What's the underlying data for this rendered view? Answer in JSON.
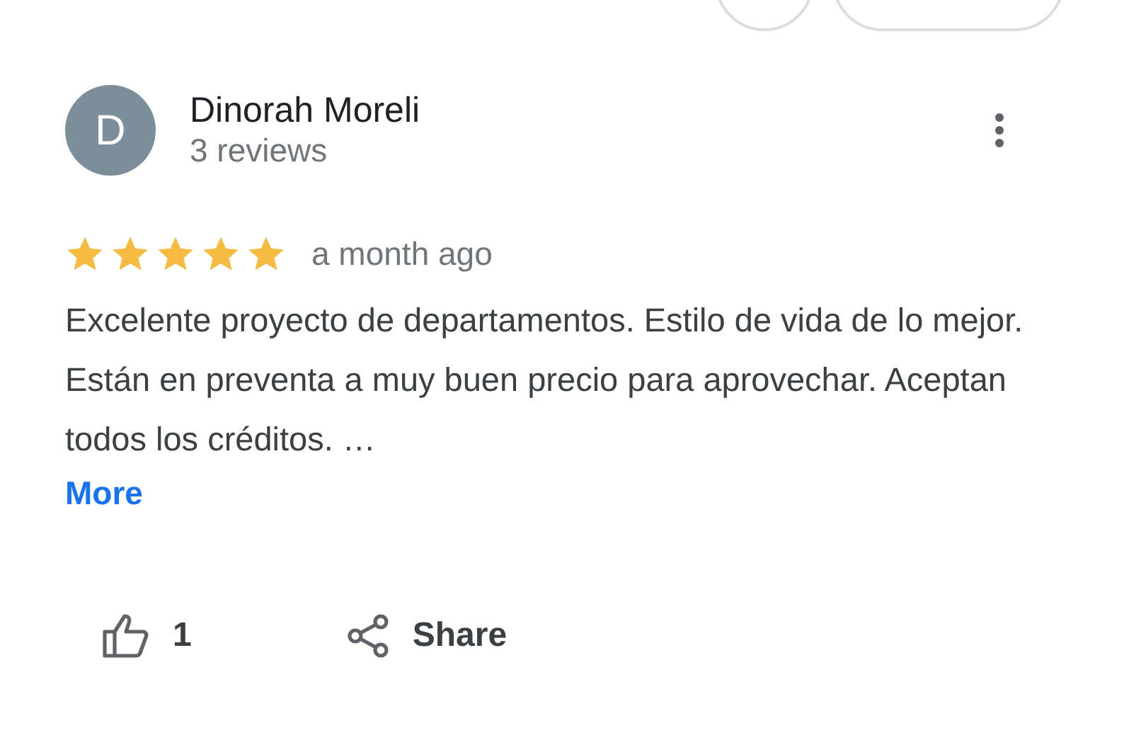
{
  "review": {
    "avatar_letter": "D",
    "author": "Dinorah Moreli",
    "review_count": "3 reviews",
    "stars": 5,
    "time": "a month ago",
    "text": "Excelente proyecto de departamentos. Estilo de vida de lo mejor. Están en preventa a muy buen precio para aprovechar. Aceptan todos los créditos. …",
    "more_link": "More",
    "like_count": "1",
    "share_label": "Share"
  }
}
